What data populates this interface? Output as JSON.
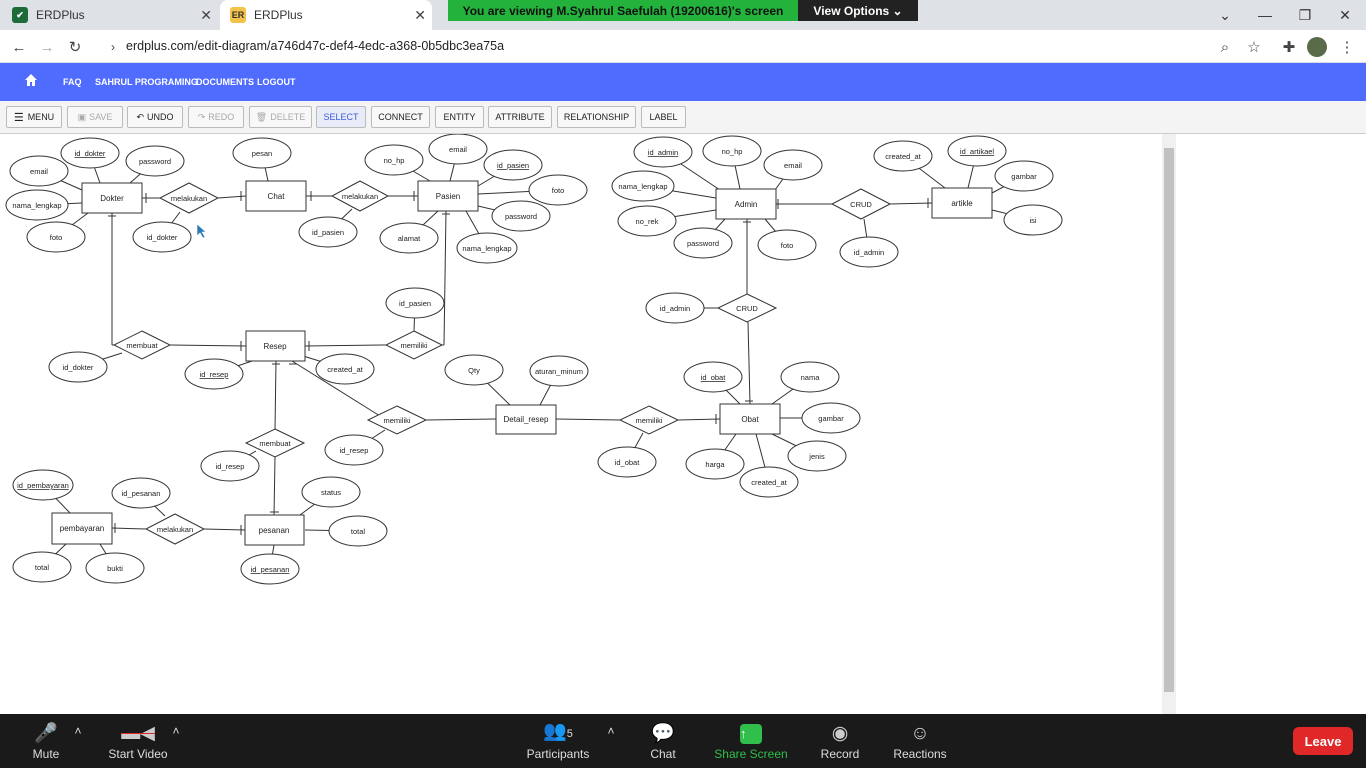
{
  "browser": {
    "tabs": [
      {
        "title": "ERDPlus",
        "close": "✕"
      },
      {
        "title": "ERDPlus",
        "close": "✕",
        "favicon": "ER"
      }
    ],
    "share_banner": "You are viewing M.Syahrul Saefulah (19200616)'s screen",
    "view_options": "View Options ⌄",
    "url": "erdplus.com/edit-diagram/a746d47c-def4-4edc-a368-0b5dbc3ea75a"
  },
  "nav": {
    "items": [
      "FAQ",
      "SAHRUL PROGRAMING",
      "DOCUMENTS",
      "LOGOUT"
    ]
  },
  "toolbar": {
    "menu": "MENU",
    "save": "SAVE",
    "undo": "UNDO",
    "redo": "REDO",
    "delete": "DELETE",
    "select": "SELECT",
    "connect": "CONNECT",
    "entity": "ENTITY",
    "attribute": "ATTRIBUTE",
    "relationship": "RELATIONSHIP",
    "label": "LABEL"
  },
  "diagram": {
    "entities": [
      "Dokter",
      "Chat",
      "Pasien",
      "Admin",
      "artikle",
      "Resep",
      "Detail_resep",
      "Obat",
      "pembayaran",
      "pesanan"
    ],
    "relationships": [
      "melakukan",
      "melakukan",
      "CRUD",
      "CRUD",
      "membuat",
      "memiliki",
      "memiliki",
      "memiliki",
      "membuat",
      "melakukan"
    ],
    "attributes": {
      "dokter": [
        "id_dokter",
        "password",
        "email",
        "nama_lengkap",
        "foto",
        "id_dokter"
      ],
      "chat": [
        "pesan",
        "id_pasien"
      ],
      "pasien": [
        "no_hp",
        "email",
        "id_pasien",
        "foto",
        "password",
        "nama_lengkap",
        "alamat",
        "id_pasien"
      ],
      "admin": [
        "id_admin",
        "no_hp",
        "email",
        "nama_lengkap",
        "no_rek",
        "password",
        "foto",
        "id_admin",
        "id_admin"
      ],
      "artikle": [
        "created_at",
        "id_artikael",
        "gambar",
        "isi"
      ],
      "resep": [
        "id_dokter",
        "id_resep",
        "created_at",
        "id_resep",
        "id_resep"
      ],
      "detail_resep": [
        "Qty",
        "aturan_minum",
        "id_obat"
      ],
      "obat": [
        "id_obat",
        "nama",
        "gambar",
        "jenis",
        "harga",
        "created_at"
      ],
      "pembayaran": [
        "id_pembayaran",
        "id_pesanan",
        "total",
        "bukti"
      ],
      "pesanan": [
        "status",
        "total",
        "id_pesanan"
      ]
    }
  },
  "zoom": {
    "mute": "Mute",
    "start_video": "Start Video",
    "participants": "Participants",
    "participants_count": "5",
    "chat": "Chat",
    "share_screen": "Share Screen",
    "record": "Record",
    "reactions": "Reactions",
    "leave": "Leave"
  }
}
